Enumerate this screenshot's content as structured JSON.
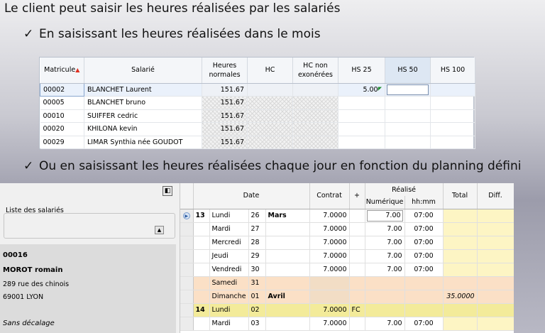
{
  "headline": "Le client peut saisir les heures réalisées par les salariés",
  "bullets": [
    {
      "check": "✓",
      "text": "En saisissant les heures réalisées dans le mois"
    },
    {
      "check": "✓",
      "text": "Ou en saisissant les heures réalisées chaque jour en fonction du planning défini"
    }
  ],
  "grid1": {
    "headers": {
      "matricule": "Matricule",
      "salarie": "Salarié",
      "heures_normales_1": "Heures",
      "heures_normales_2": "normales",
      "hc": "HC",
      "hc_non_1": "HC non",
      "hc_non_2": "exonérées",
      "hs25": "HS 25",
      "hs50": "HS 50",
      "hs100": "HS 100"
    },
    "rows": [
      {
        "matricule": "00002",
        "salarie": "BLANCHET Laurent",
        "heures": "151.67",
        "hs25": "5.00"
      },
      {
        "matricule": "00005",
        "salarie": "BLANCHET bruno",
        "heures": "151.67",
        "hs25": ""
      },
      {
        "matricule": "00010",
        "salarie": "SUIFFER cedric",
        "heures": "151.67",
        "hs25": ""
      },
      {
        "matricule": "00020",
        "salarie": "KHILONA kevin",
        "heures": "151.67",
        "hs25": ""
      },
      {
        "matricule": "00029",
        "salarie": "LIMAR Synthia née GOUDOT",
        "heures": "151.67",
        "hs25": ""
      }
    ]
  },
  "left": {
    "list_label": "Liste des salariés",
    "employee": {
      "id": "00016",
      "name": "MOROT romain",
      "address1": "289 rue des chinois",
      "address2": "69001 LYON",
      "offset": "Sans décalage"
    }
  },
  "grid2": {
    "headers": {
      "date": "Date",
      "contrat": "Contrat",
      "plus": "+",
      "realise": "Réalisé",
      "numerique": "Numérique",
      "hhmm": "hh:mm",
      "total": "Total",
      "diff": "Diff."
    },
    "rows": [
      {
        "week": "13",
        "day": "Lundi",
        "num": "26",
        "month": "Mars",
        "contrat": "7.0000",
        "plus": "",
        "numerique": "7.00",
        "hhmm": "07:00",
        "total": "",
        "type": "current"
      },
      {
        "week": "",
        "day": "Mardi",
        "num": "27",
        "month": "",
        "contrat": "7.0000",
        "plus": "",
        "numerique": "7.00",
        "hhmm": "07:00",
        "total": "",
        "type": "normal"
      },
      {
        "week": "",
        "day": "Mercredi",
        "num": "28",
        "month": "",
        "contrat": "7.0000",
        "plus": "",
        "numerique": "7.00",
        "hhmm": "07:00",
        "total": "",
        "type": "normal"
      },
      {
        "week": "",
        "day": "Jeudi",
        "num": "29",
        "month": "",
        "contrat": "7.0000",
        "plus": "",
        "numerique": "7.00",
        "hhmm": "07:00",
        "total": "",
        "type": "normal"
      },
      {
        "week": "",
        "day": "Vendredi",
        "num": "30",
        "month": "",
        "contrat": "7.0000",
        "plus": "",
        "numerique": "7.00",
        "hhmm": "07:00",
        "total": "",
        "type": "normal"
      },
      {
        "week": "",
        "day": "Samedi",
        "num": "31",
        "month": "",
        "contrat": "",
        "plus": "",
        "numerique": "",
        "hhmm": "",
        "total": "",
        "type": "weekend"
      },
      {
        "week": "",
        "day": "Dimanche",
        "num": "01",
        "month": "Avril",
        "contrat": "",
        "plus": "",
        "numerique": "",
        "hhmm": "",
        "total": "35.0000",
        "type": "weekend"
      },
      {
        "week": "14",
        "day": "Lundi",
        "num": "02",
        "month": "",
        "contrat": "7.0000",
        "plus": "FC",
        "numerique": "",
        "hhmm": "",
        "total": "",
        "type": "week"
      },
      {
        "week": "",
        "day": "Mardi",
        "num": "03",
        "month": "",
        "contrat": "7.0000",
        "plus": "",
        "numerique": "7.00",
        "hhmm": "07:00",
        "total": "",
        "type": "normal"
      }
    ]
  },
  "colors": {
    "yellow_col": "#fdf5c4",
    "weekend": "#fbe0c6",
    "week_row": "#f3eb9a",
    "sort_arrow": "#e03020"
  }
}
